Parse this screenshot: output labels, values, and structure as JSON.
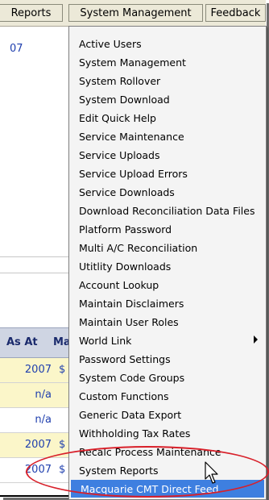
{
  "menubar": {
    "items": [
      "Reports",
      "System Management",
      "Feedback"
    ]
  },
  "left_panel": {
    "partial_link": "07",
    "table": {
      "headers": [
        "As At",
        "Ma"
      ],
      "rows": [
        {
          "col1": "2007",
          "col2": "$"
        },
        {
          "col1": "n/a",
          "col2": ""
        },
        {
          "col1": "n/a",
          "col2": ""
        },
        {
          "col1": "2007",
          "col2": "$"
        },
        {
          "col1": "2007",
          "col2": "$"
        }
      ]
    }
  },
  "dropdown": {
    "items": [
      {
        "label": "Active Users"
      },
      {
        "label": "System Management"
      },
      {
        "label": "System Rollover"
      },
      {
        "label": "System Download"
      },
      {
        "label": "Edit Quick Help"
      },
      {
        "label": "Service Maintenance"
      },
      {
        "label": "Service Uploads"
      },
      {
        "label": "Service Upload Errors"
      },
      {
        "label": "Service Downloads"
      },
      {
        "label": "Download Reconciliation Data Files"
      },
      {
        "label": "Platform Password"
      },
      {
        "label": "Multi A/C Reconciliation"
      },
      {
        "label": "Utitlity Downloads"
      },
      {
        "label": "Account Lookup"
      },
      {
        "label": "Maintain Disclaimers"
      },
      {
        "label": "Maintain User Roles"
      },
      {
        "label": "World Link",
        "submenu": true
      },
      {
        "label": "Password Settings"
      },
      {
        "label": "System Code Groups"
      },
      {
        "label": "Custom Functions"
      },
      {
        "label": "Generic Data Export"
      },
      {
        "label": "Withholding Tax Rates"
      },
      {
        "label": "Recalc Process Maintenance"
      },
      {
        "label": "System Reports"
      },
      {
        "label": "Macquarie CMT Direct Feed",
        "highlighted": true
      }
    ]
  },
  "colors": {
    "menubar_bg": "#ece9d8",
    "menu_bg": "#f4f4f4",
    "highlight": "#3e7fe0",
    "link": "#1f3fae",
    "header_bg": "#cfd5e3",
    "row_yellow": "#fbf6c9",
    "annotation": "#d8202a"
  }
}
